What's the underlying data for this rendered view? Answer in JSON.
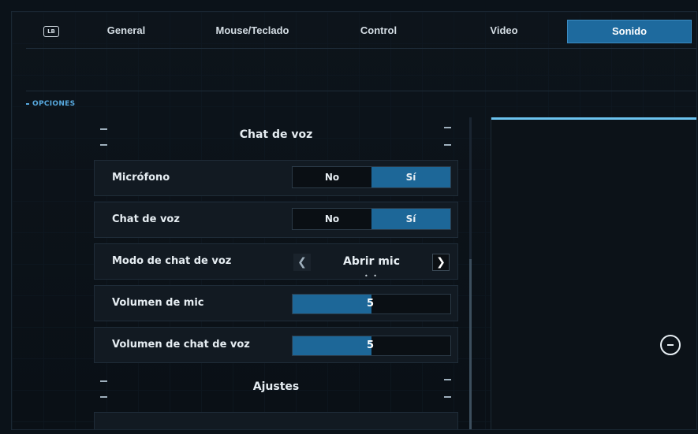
{
  "topbar": {
    "bumper_icon": "LB",
    "tabs": [
      {
        "label": "General"
      },
      {
        "label": "Mouse/Teclado"
      },
      {
        "label": "Control"
      },
      {
        "label": "Video"
      },
      {
        "label": "Sonido",
        "active": true
      }
    ]
  },
  "section": {
    "label": "OPCIONES"
  },
  "groups": [
    {
      "title": "Chat de voz"
    },
    {
      "title": "Ajustes"
    }
  ],
  "rows": [
    {
      "label": "Micrófono",
      "type": "toggle",
      "off_label": "No",
      "on_label": "Sí",
      "selected": "Sí"
    },
    {
      "label": "Chat de voz",
      "type": "toggle",
      "off_label": "No",
      "on_label": "Sí",
      "selected": "Sí"
    },
    {
      "label": "Modo de chat de voz",
      "type": "selector",
      "value": "Abrir mic",
      "left_glyph": "❮",
      "right_glyph": "❯",
      "dots": "• •"
    },
    {
      "label": "Volumen de mic",
      "type": "slider",
      "value": "5",
      "level": 0.5
    },
    {
      "label": "Volumen de chat de voz",
      "type": "slider",
      "value": "5",
      "level": 0.5
    }
  ],
  "colors": {
    "accent": "#1d6798",
    "highlight": "#6cc3ef",
    "section": "#57a9df"
  },
  "preview": {
    "icon": "refresh-ring-icon"
  }
}
